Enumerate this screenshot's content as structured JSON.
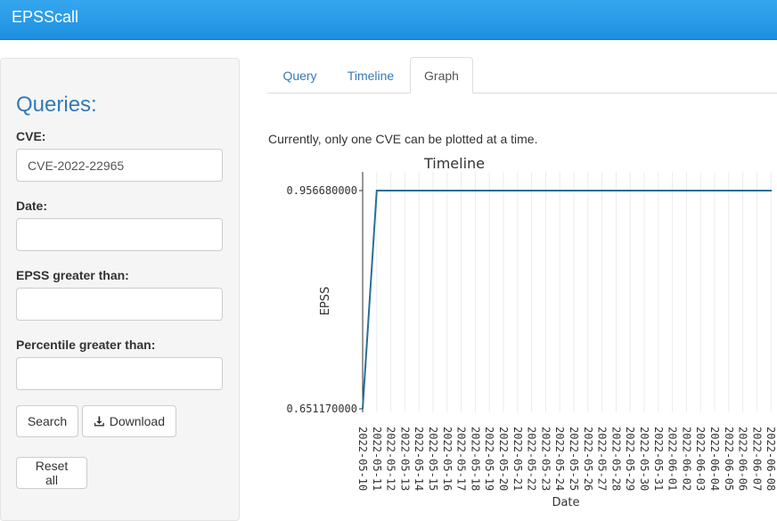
{
  "app": {
    "title": "EPSScall"
  },
  "sidebar": {
    "heading": "Queries:",
    "cve": {
      "label": "CVE:",
      "value": "CVE-2022-22965"
    },
    "date": {
      "label": "Date:",
      "value": ""
    },
    "epss": {
      "label": "EPSS greater than:",
      "value": ""
    },
    "percentile": {
      "label": "Percentile greater than:",
      "value": ""
    },
    "buttons": {
      "search": "Search",
      "download": "Download",
      "reset": "Reset all"
    }
  },
  "tabs": [
    {
      "label": "Query",
      "active": false
    },
    {
      "label": "Timeline",
      "active": false
    },
    {
      "label": "Graph",
      "active": true
    }
  ],
  "main": {
    "note": "Currently, only one CVE can be plotted at a time."
  },
  "colors": {
    "accent": "#337ab7",
    "line": "#2a6f97",
    "topbar": "#1e8fe0"
  },
  "chart_data": {
    "type": "line",
    "title": "Timeline",
    "xlabel": "Date",
    "ylabel": "EPSS",
    "y_ticks": [
      "0.651170000",
      "0.956680000"
    ],
    "ylim": [
      0.65117,
      0.95668
    ],
    "x": [
      "2022-05-10",
      "2022-05-11",
      "2022-05-12",
      "2022-05-13",
      "2022-05-14",
      "2022-05-15",
      "2022-05-16",
      "2022-05-17",
      "2022-05-18",
      "2022-05-19",
      "2022-05-20",
      "2022-05-21",
      "2022-05-22",
      "2022-05-23",
      "2022-05-24",
      "2022-05-25",
      "2022-05-26",
      "2022-05-27",
      "2022-05-28",
      "2022-05-29",
      "2022-05-30",
      "2022-05-31",
      "2022-06-01",
      "2022-06-02",
      "2022-06-03",
      "2022-06-04",
      "2022-06-05",
      "2022-06-06",
      "2022-06-07",
      "2022-06-08"
    ],
    "values": [
      0.65117,
      0.95668,
      0.95668,
      0.95668,
      0.95668,
      0.95668,
      0.95668,
      0.95668,
      0.95668,
      0.95668,
      0.95668,
      0.95668,
      0.95668,
      0.95668,
      0.95668,
      0.95668,
      0.95668,
      0.95668,
      0.95668,
      0.95668,
      0.95668,
      0.95668,
      0.95668,
      0.95668,
      0.95668,
      0.95668,
      0.95668,
      0.95668,
      0.95668,
      0.95668
    ],
    "grid": true,
    "legend": "none"
  }
}
